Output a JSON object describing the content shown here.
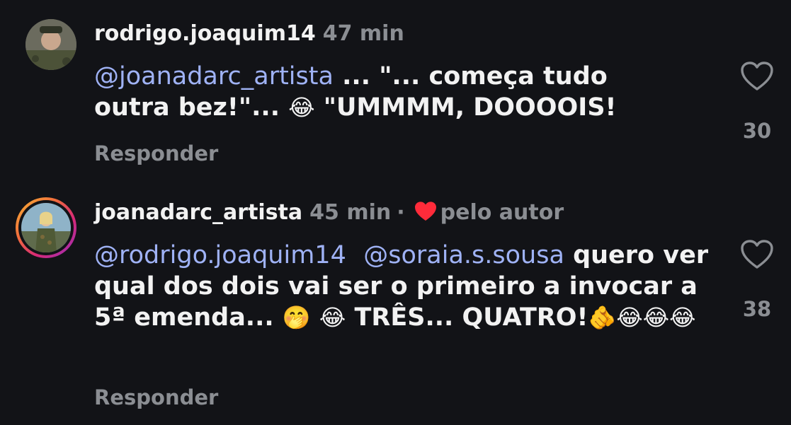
{
  "comments": [
    {
      "username": "rodrigo.joaquim14",
      "time": "47 min",
      "text_parts": [
        {
          "type": "mention",
          "text": "@joanadarc_artista"
        },
        {
          "type": "text",
          "text": " ... \"... começa tudo outra bez!\"... "
        },
        {
          "type": "emoji",
          "text": "😂"
        },
        {
          "type": "text",
          "text": " \"UMMMM, DOOOOIS!"
        }
      ],
      "reply_label": "Responder",
      "like_count": "30",
      "icon": "heart-outline-icon"
    },
    {
      "username": "joanadarc_artista",
      "time": "45 min",
      "separator": "·",
      "liked_by_author_label": "pelo autor",
      "text_parts": [
        {
          "type": "mention",
          "text": "@rodrigo.joaquim14"
        },
        {
          "type": "text",
          "text": "  "
        },
        {
          "type": "mention",
          "text": "@soraia.s.sousa"
        },
        {
          "type": "text",
          "text": " quero ver qual dos dois vai ser o primeiro a invocar a 5ª emenda... "
        },
        {
          "type": "emoji",
          "text": "🤭"
        },
        {
          "type": "text",
          "text": " "
        },
        {
          "type": "emoji",
          "text": "😂"
        },
        {
          "type": "text",
          "text": " TRÊS... QUATRO!"
        },
        {
          "type": "emoji",
          "text": "🫵"
        },
        {
          "type": "emoji",
          "text": "😂😂😂"
        }
      ],
      "reply_label": "Responder",
      "like_count": "38",
      "icon": "heart-outline-icon"
    }
  ],
  "colors": {
    "background": "#121317",
    "mention": "#9fb2f5",
    "muted": "#8b8e93",
    "author_heart": "#ff2b3a"
  }
}
